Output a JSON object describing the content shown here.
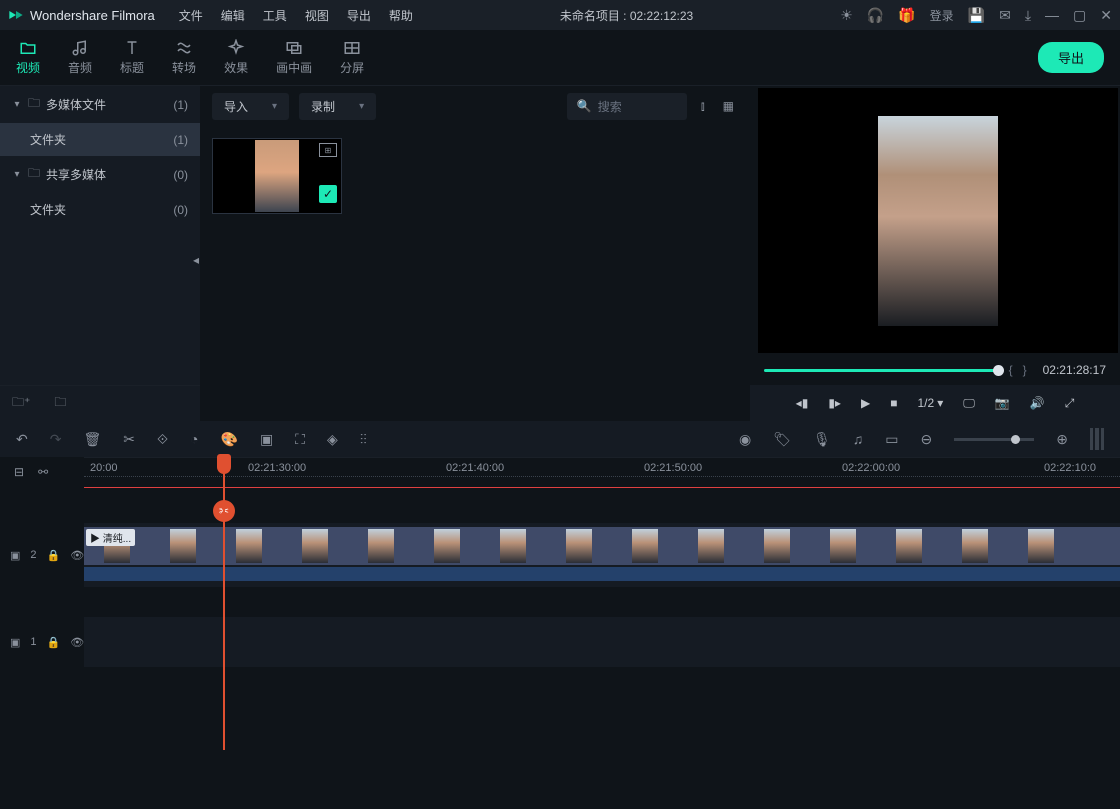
{
  "app": {
    "name": "Wondershare Filmora"
  },
  "menu": {
    "file": "文件",
    "edit": "编辑",
    "tools": "工具",
    "view": "视图",
    "export": "导出",
    "help": "帮助"
  },
  "project": {
    "title": "未命名项目 : 02:22:12:23"
  },
  "titlebar": {
    "login": "登录"
  },
  "tabs": {
    "video": "视频",
    "audio": "音频",
    "title": "标题",
    "transition": "转场",
    "effect": "效果",
    "pip": "画中画",
    "split": "分屏"
  },
  "export_btn": "导出",
  "sidebar": {
    "items": [
      {
        "label": "多媒体文件",
        "count": "(1)"
      },
      {
        "label": "文件夹",
        "count": "(1)"
      },
      {
        "label": "共享多媒体",
        "count": "(0)"
      },
      {
        "label": "文件夹",
        "count": "(0)"
      }
    ]
  },
  "media_bar": {
    "import": "导入",
    "record": "录制",
    "search": "搜索"
  },
  "preview": {
    "time": "02:21:28:17",
    "speed": "1/2",
    "speed_arrow": "▾"
  },
  "ruler": {
    "t0": "20:00",
    "t1": "02:21:30:00",
    "t2": "02:21:40:00",
    "t3": "02:21:50:00",
    "t4": "02:22:00:00",
    "t5": "02:22:10:0"
  },
  "clip": {
    "label": "▶ 清纯..."
  },
  "tracks": {
    "row2": "2",
    "row1": "1"
  }
}
